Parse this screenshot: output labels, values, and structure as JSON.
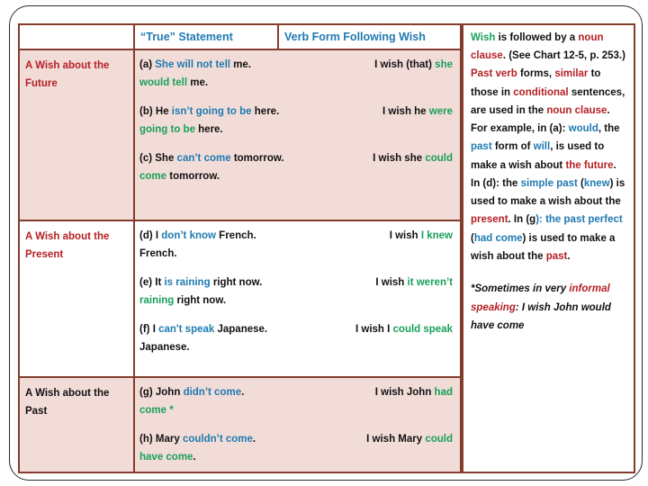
{
  "table": {
    "headers": {
      "blank": "",
      "true_statement": "“True” Statement",
      "verb_form": "Verb Form Following Wish"
    },
    "rows": [
      {
        "category_line1": "A Wish about the",
        "category_line2": "Future",
        "examples": [
          {
            "label": "(a)",
            "stmt_parts": [
              {
                "t": " She will not tell ",
                "c": "blue"
              },
              {
                "t": "me.",
                "c": "blk"
              }
            ],
            "wish_parts": [
              {
                "t": "I wish (that) ",
                "c": "blk"
              },
              {
                "t": "she",
                "c": "green"
              }
            ],
            "cont_parts": [
              {
                "t": "would tell ",
                "c": "green"
              },
              {
                "t": "me.",
                "c": "blk"
              }
            ]
          },
          {
            "label": "(b)",
            "stmt_parts": [
              {
                "t": " He ",
                "c": "blk"
              },
              {
                "t": "isn’t going to be ",
                "c": "blue"
              },
              {
                "t": "here.",
                "c": "blk"
              }
            ],
            "wish_parts": [
              {
                "t": "I wish he ",
                "c": "blk"
              },
              {
                "t": "were",
                "c": "green"
              }
            ],
            "cont_parts": [
              {
                "t": "going to be ",
                "c": "green"
              },
              {
                "t": "here.",
                "c": "blk"
              }
            ]
          },
          {
            "label": "(c)",
            "stmt_parts": [
              {
                "t": " She ",
                "c": "blk"
              },
              {
                "t": "can’t come ",
                "c": "blue"
              },
              {
                "t": "tomorrow.",
                "c": "blk"
              }
            ],
            "wish_parts": [
              {
                "t": "I wish she ",
                "c": "blk"
              },
              {
                "t": "could",
                "c": "green"
              }
            ],
            "cont_parts": [
              {
                "t": "come ",
                "c": "green"
              },
              {
                "t": "tomorrow.",
                "c": "blk"
              }
            ]
          }
        ]
      },
      {
        "category_line1": "A Wish about the",
        "category_line2": "Present",
        "examples": [
          {
            "label": "(d)",
            "stmt_parts": [
              {
                "t": " I ",
                "c": "blk"
              },
              {
                "t": "don’t know ",
                "c": "blue"
              },
              {
                "t": "French.",
                "c": "blk"
              }
            ],
            "wish_parts": [
              {
                "t": "I wish ",
                "c": "blk"
              },
              {
                "t": "I knew",
                "c": "green"
              }
            ],
            "cont_parts": [
              {
                "t": "French.",
                "c": "blk"
              }
            ]
          },
          {
            "label": "(e)",
            "stmt_parts": [
              {
                "t": " It ",
                "c": "blk"
              },
              {
                "t": "is raining ",
                "c": "blue"
              },
              {
                "t": "right now.",
                "c": "blk"
              }
            ],
            "wish_parts": [
              {
                "t": "I wish ",
                "c": "blk"
              },
              {
                "t": "it weren’t",
                "c": "green"
              }
            ],
            "cont_parts": [
              {
                "t": "raining ",
                "c": "green"
              },
              {
                "t": "right now.",
                "c": "blk"
              }
            ]
          },
          {
            "label": "(f)",
            "stmt_parts": [
              {
                "t": " I ",
                "c": "blk"
              },
              {
                "t": "can't speak ",
                "c": "blue"
              },
              {
                "t": "Japanese.",
                "c": "blk"
              }
            ],
            "wish_parts": [
              {
                "t": "I wish I ",
                "c": "blk"
              },
              {
                "t": "could speak",
                "c": "green"
              }
            ],
            "cont_parts": [
              {
                "t": "Japanese.",
                "c": "blk"
              }
            ]
          }
        ]
      },
      {
        "category_line1": "A Wish about the",
        "category_line2": "Past",
        "examples": [
          {
            "label": "(g)",
            "stmt_parts": [
              {
                "t": " John ",
                "c": "blk"
              },
              {
                "t": "didn’t come",
                "c": "blue"
              },
              {
                "t": ".",
                "c": "blk"
              }
            ],
            "wish_parts": [
              {
                "t": "I wish John ",
                "c": "blk"
              },
              {
                "t": "had",
                "c": "green"
              }
            ],
            "cont_parts": [
              {
                "t": "come *",
                "c": "green"
              }
            ]
          },
          {
            "label": "(h)",
            "stmt_parts": [
              {
                "t": " Mary ",
                "c": "blk"
              },
              {
                "t": "couldn’t come",
                "c": "blue"
              },
              {
                "t": ".",
                "c": "blk"
              }
            ],
            "wish_parts": [
              {
                "t": "I wish Mary ",
                "c": "blk"
              },
              {
                "t": "could",
                "c": "green"
              }
            ],
            "cont_parts": [
              {
                "t": "have come",
                "c": "green"
              },
              {
                "t": ".",
                "c": "blk"
              }
            ]
          }
        ]
      }
    ]
  },
  "explanation": {
    "parts": [
      {
        "t": "Wish",
        "c": "green"
      },
      {
        "t": " is followed by a ",
        "c": "blk"
      },
      {
        "t": "noun clause",
        "c": "red"
      },
      {
        "t": ". (See Chart 12-5, p. 253.) ",
        "c": "blk"
      },
      {
        "t": "Past verb",
        "c": "red"
      },
      {
        "t": " forms, ",
        "c": "blk"
      },
      {
        "t": "similar",
        "c": "red"
      },
      {
        "t": " to those in ",
        "c": "blk"
      },
      {
        "t": "conditional",
        "c": "red"
      },
      {
        "t": " sentences, are used in the ",
        "c": "blk"
      },
      {
        "t": "noun clause",
        "c": "red"
      },
      {
        "t": ". For example, in (a): ",
        "c": "blk"
      },
      {
        "t": "would",
        "c": "blue"
      },
      {
        "t": ", the ",
        "c": "blk"
      },
      {
        "t": "past",
        "c": "blue"
      },
      {
        "t": " form of ",
        "c": "blk"
      },
      {
        "t": "will",
        "c": "blue"
      },
      {
        "t": ", is used to make a wish about ",
        "c": "blk"
      },
      {
        "t": "the future",
        "c": "red"
      },
      {
        "t": ". In (d): the ",
        "c": "blk"
      },
      {
        "t": "simple past",
        "c": "blue"
      },
      {
        "t": " (",
        "c": "blk"
      },
      {
        "t": "knew",
        "c": "blue"
      },
      {
        "t": ") is used to make a wish about the ",
        "c": "blk"
      },
      {
        "t": "present",
        "c": "red"
      },
      {
        "t": ". In (g",
        "c": "blk"
      },
      {
        "t": "): the past perfect",
        "c": "blue"
      },
      {
        "t": " (",
        "c": "blk"
      },
      {
        "t": "had come",
        "c": "blue"
      },
      {
        "t": ") is used to make a wish about the ",
        "c": "blk"
      },
      {
        "t": "past",
        "c": "red"
      },
      {
        "t": ".",
        "c": "blk"
      }
    ],
    "footnote_parts": [
      {
        "t": " *Sometimes in very ",
        "c": "blk"
      },
      {
        "t": "informal speaking",
        "c": "red"
      },
      {
        "t": ": I wish John would have come",
        "c": "blk"
      }
    ]
  },
  "colors": {
    "border": "#843c2c",
    "row_fill": "#f2dcd8",
    "blue": "#1f7ab0",
    "green": "#18a05a",
    "red": "#b52025",
    "black": "#111111"
  }
}
